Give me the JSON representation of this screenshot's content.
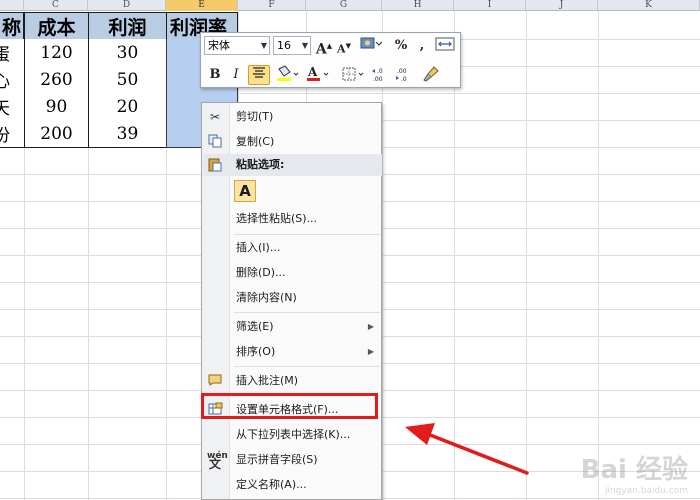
{
  "columns": [
    "C",
    "D",
    "E",
    "F",
    "G",
    "H",
    "I",
    "J",
    "K"
  ],
  "table": {
    "headers": [
      "称",
      "成本",
      "利润",
      "利润率"
    ],
    "rows": [
      [
        "蛋",
        "120",
        "30",
        ""
      ],
      [
        "心",
        "260",
        "50",
        ""
      ],
      [
        "天",
        "90",
        "20",
        ""
      ],
      [
        "份",
        "200",
        "39",
        ""
      ]
    ]
  },
  "mini_toolbar": {
    "font": "宋体",
    "size": "16",
    "grow_font": "A",
    "shrink_font": "A",
    "bold": "B",
    "italic": "I",
    "font_color": "A",
    "percent": "%",
    "comma": ",",
    "increase_decimal": ".0 .00",
    "decrease_decimal": ".00 .0"
  },
  "context_menu": {
    "cut": "剪切(T)",
    "copy": "复制(C)",
    "paste_options": "粘贴选项:",
    "paste_a": "A",
    "paste_special": "选择性粘贴(S)...",
    "insert": "插入(I)...",
    "delete": "删除(D)...",
    "clear": "清除内容(N)",
    "filter": "筛选(E)",
    "sort": "排序(O)",
    "insert_comment": "插入批注(M)",
    "format_cells": "设置单元格格式(F)...",
    "pick_from_list": "从下拉列表中选择(K)...",
    "phonetic": "显示拼音字段(S)",
    "define_name": "定义名称(A)..."
  },
  "watermark": {
    "main": "Bai 经验",
    "sub": "jingyan.baidu.com"
  },
  "colors": {
    "header_fill": "#b8cce4",
    "selection_fill": "#b6cef0",
    "annotation_red": "#e21b1b"
  }
}
